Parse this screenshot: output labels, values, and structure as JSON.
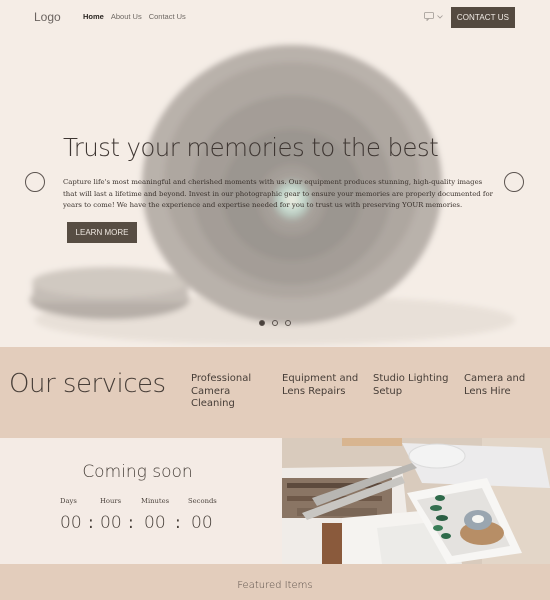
{
  "header": {
    "logo": "Logo",
    "nav": [
      {
        "label": "Home",
        "active": true
      },
      {
        "label": "About Us",
        "active": false
      },
      {
        "label": "Contact Us",
        "active": false
      }
    ],
    "language_icon": "chat-translate-icon",
    "contact_button": "CONTACT US"
  },
  "hero": {
    "title": "Trust your memories to the best",
    "text": "Capture life's most meaningful and cherished moments with us. Our equipment produces stunning, high-quality images that will last a lifetime and beyond. Invest in our photographic gear to ensure your memories are properly documented for years to come! We have the experience and expertise needed for you to trust us with preserving YOUR memories.",
    "button": "LEARN MORE",
    "slides_total": 3,
    "active_slide": 1
  },
  "services": {
    "title": "Our services",
    "items": [
      "Professional Camera Cleaning",
      "Equipment and Lens Repairs",
      "Studio Lighting Setup",
      "Camera and Lens Hire"
    ]
  },
  "countdown": {
    "title": "Coming soon",
    "units": [
      {
        "label": "Days",
        "value": "00"
      },
      {
        "label": "Hours",
        "value": "00"
      },
      {
        "label": "Minutes",
        "value": "00"
      },
      {
        "label": "Seconds",
        "value": "00"
      }
    ],
    "separator": ":"
  },
  "featured": {
    "title": "Featured Items"
  },
  "colors": {
    "background": "#f4ece6",
    "band": "#e3cdbc",
    "button": "#554a41",
    "text": "#463d37"
  }
}
